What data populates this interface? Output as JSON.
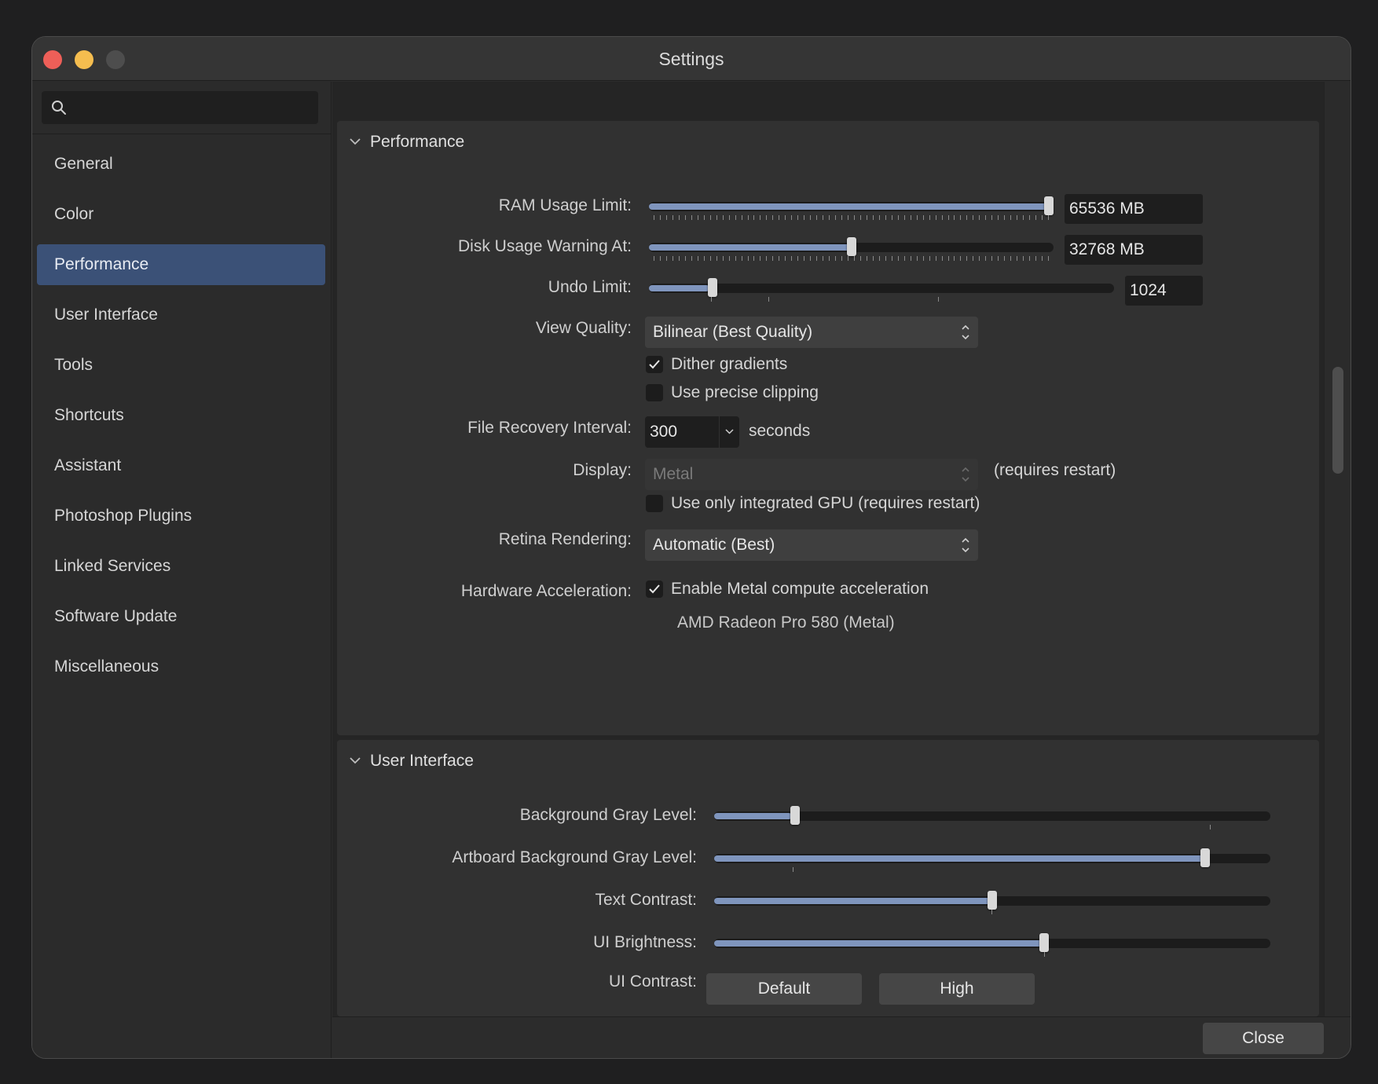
{
  "window": {
    "title": "Settings",
    "traffic_lights": {
      "close": "#ee5f58",
      "minimize": "#f5bd4f",
      "zoom": "#4d4d4d"
    }
  },
  "sidebar": {
    "search": {
      "placeholder": "",
      "icon": "search-icon"
    },
    "items": [
      {
        "label": "General"
      },
      {
        "label": "Color"
      },
      {
        "label": "Performance",
        "selected": true
      },
      {
        "label": "User Interface"
      },
      {
        "label": "Tools"
      },
      {
        "label": "Shortcuts"
      },
      {
        "label": "Assistant"
      },
      {
        "label": "Photoshop Plugins"
      },
      {
        "label": "Linked Services"
      },
      {
        "label": "Software Update"
      },
      {
        "label": "Miscellaneous"
      }
    ]
  },
  "performance": {
    "heading": "Performance",
    "ram": {
      "label": "RAM Usage Limit:",
      "value": "65536 MB",
      "fraction": 1.0
    },
    "disk": {
      "label": "Disk Usage Warning At:",
      "value": "32768 MB",
      "fraction": 0.5
    },
    "undo": {
      "label": "Undo Limit:",
      "value": "1024",
      "fraction": 0.13
    },
    "view_quality": {
      "label": "View Quality:",
      "value": "Bilinear (Best Quality)"
    },
    "dither": {
      "label": "Dither gradients",
      "checked": true
    },
    "precise_clipping": {
      "label": "Use precise clipping",
      "checked": false
    },
    "file_recovery": {
      "label": "File Recovery Interval:",
      "value": "300",
      "unit": "seconds"
    },
    "display": {
      "label": "Display:",
      "value": "Metal",
      "note": "(requires restart)",
      "disabled": true
    },
    "integrated_gpu": {
      "label": "Use only integrated GPU (requires restart)",
      "checked": false
    },
    "retina": {
      "label": "Retina Rendering:",
      "value": "Automatic (Best)"
    },
    "hw_accel": {
      "label": "Hardware Acceleration:",
      "option": "Enable Metal compute acceleration",
      "checked": true,
      "device": "AMD Radeon Pro 580 (Metal)"
    }
  },
  "user_interface": {
    "heading": "User Interface",
    "bg_gray": {
      "label": "Background Gray Level:",
      "fraction": 0.14
    },
    "artboard_gray": {
      "label": "Artboard Background Gray Level:",
      "fraction": 0.89
    },
    "text_contrast": {
      "label": "Text Contrast:",
      "fraction": 0.5
    },
    "ui_brightness": {
      "label": "UI Brightness:",
      "fraction": 0.595
    },
    "ui_contrast": {
      "label": "UI Contrast:",
      "options": [
        "Default",
        "High"
      ]
    }
  },
  "footer": {
    "close_label": "Close"
  },
  "colors": {
    "accent": "#3b5177",
    "slider_fill": "#7f95bd"
  }
}
